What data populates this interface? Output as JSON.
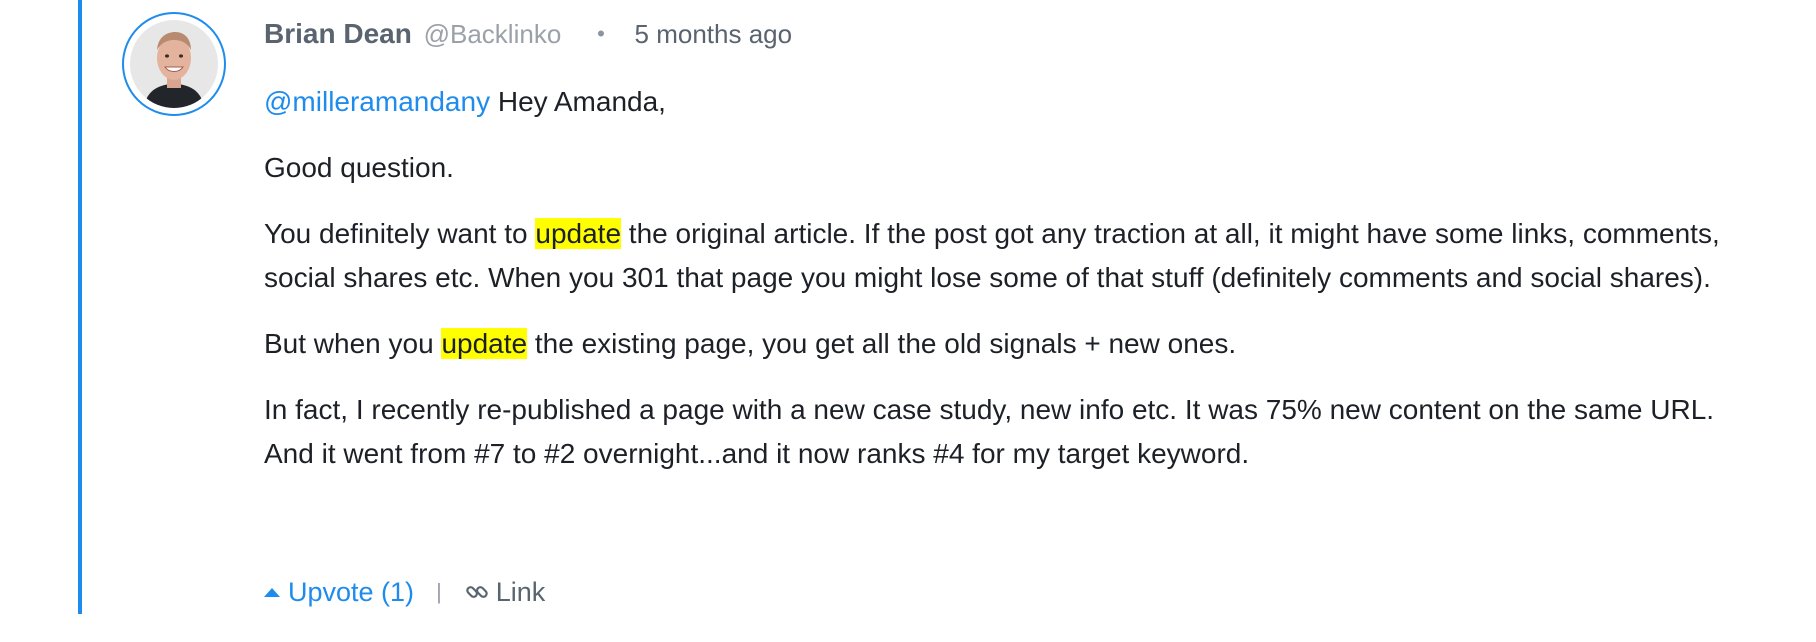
{
  "comment": {
    "author": "Brian Dean",
    "handle": "@Backlinko",
    "separator": "•",
    "time": "5 months ago",
    "avatar_icon": "avatar-photo",
    "paragraphs": [
      {
        "mention": "@milleramandany",
        "text": " Hey Amanda,"
      },
      {
        "text": "Good question."
      },
      {
        "before": "You definitely want to ",
        "highlight": "update",
        "after": " the original article. If the post got any traction at all, it might have some links, comments, social shares etc. When you 301 that page you might lose some of that stuff (definitely comments and social shares)."
      },
      {
        "before": "But when you ",
        "highlight": "update",
        "after": " the existing page, you get all the old signals + new ones."
      },
      {
        "text": "In fact, I recently re-published a page with a new case study, new info etc. It was 75% new content on the same URL. And it went from #7 to #2 overnight...and it now ranks #4 for my target keyword."
      }
    ]
  },
  "actions": {
    "upvote_label": "Upvote (1)",
    "divider": "|",
    "link_label": "Link",
    "upvote_icon": "caret-up-icon",
    "link_icon": "chain-link-icon"
  },
  "colors": {
    "accent": "#1e8ced",
    "highlight": "#ffff00",
    "text": "#1d2127",
    "muted": "#5a6471"
  }
}
